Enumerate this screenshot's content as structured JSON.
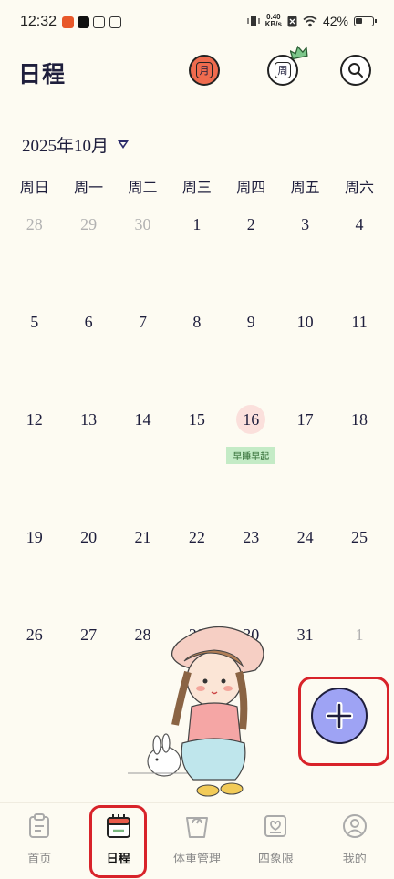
{
  "status_bar": {
    "time": "12:32",
    "net_speed_value": "0.40",
    "net_speed_unit": "KB/s",
    "battery": "42%"
  },
  "header": {
    "title": "日程",
    "month_button": "月",
    "week_button": "周"
  },
  "calendar": {
    "month_label": "2025年10月",
    "weekdays": [
      "周日",
      "周一",
      "周二",
      "周三",
      "周四",
      "周五",
      "周六"
    ],
    "weeks": [
      [
        {
          "day": "28",
          "muted": true
        },
        {
          "day": "29",
          "muted": true
        },
        {
          "day": "30",
          "muted": true
        },
        {
          "day": "1"
        },
        {
          "day": "2"
        },
        {
          "day": "3"
        },
        {
          "day": "4"
        }
      ],
      [
        {
          "day": "5"
        },
        {
          "day": "6"
        },
        {
          "day": "7"
        },
        {
          "day": "8"
        },
        {
          "day": "9"
        },
        {
          "day": "10"
        },
        {
          "day": "11"
        }
      ],
      [
        {
          "day": "12"
        },
        {
          "day": "13"
        },
        {
          "day": "14"
        },
        {
          "day": "15"
        },
        {
          "day": "16",
          "today": true,
          "event": "早睡早起"
        },
        {
          "day": "17"
        },
        {
          "day": "18"
        }
      ],
      [
        {
          "day": "19"
        },
        {
          "day": "20"
        },
        {
          "day": "21"
        },
        {
          "day": "22"
        },
        {
          "day": "23"
        },
        {
          "day": "24"
        },
        {
          "day": "25"
        }
      ],
      [
        {
          "day": "26"
        },
        {
          "day": "27"
        },
        {
          "day": "28"
        },
        {
          "day": "29"
        },
        {
          "day": "30"
        },
        {
          "day": "31"
        },
        {
          "day": "1",
          "muted": true
        }
      ]
    ]
  },
  "bottom_nav": {
    "items": [
      {
        "label": "首页",
        "icon": "clipboard-icon"
      },
      {
        "label": "日程",
        "icon": "calendar-icon",
        "active": true
      },
      {
        "label": "体重管理",
        "icon": "scale-icon"
      },
      {
        "label": "四象限",
        "icon": "quadrant-icon"
      },
      {
        "label": "我的",
        "icon": "profile-icon"
      }
    ]
  },
  "colors": {
    "background": "#fdfbf2",
    "accent_month": "#ef6b4e",
    "fab": "#9ea3f4",
    "event_tag": "#c4ebc6",
    "highlight": "#d8232a"
  }
}
